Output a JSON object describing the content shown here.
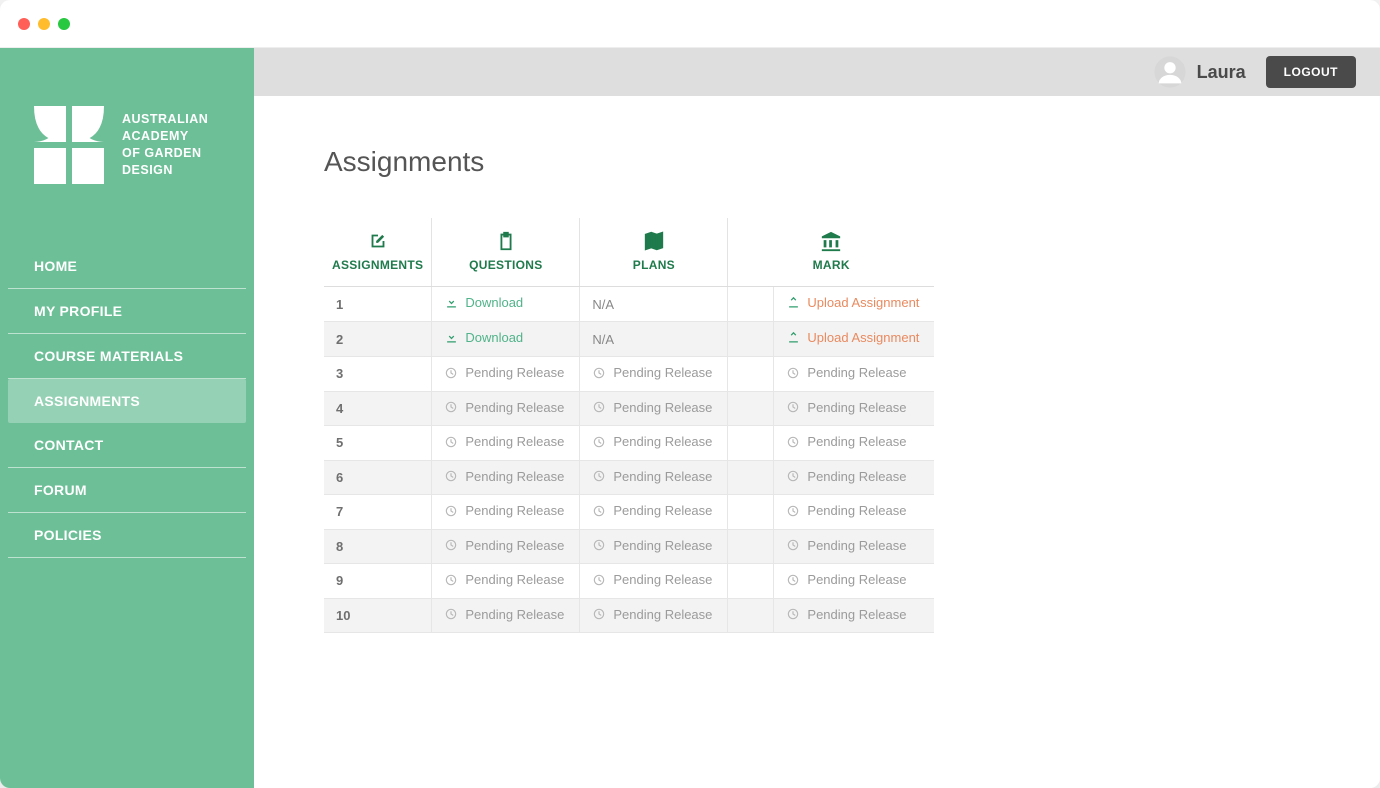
{
  "brand": {
    "line1": "AUSTRALIAN",
    "line2": "ACADEMY",
    "line3": "OF GARDEN",
    "line4": "DESIGN"
  },
  "user": {
    "name": "Laura"
  },
  "buttons": {
    "logout": "LOGOUT"
  },
  "nav": {
    "items": [
      {
        "label": "HOME",
        "active": false
      },
      {
        "label": "MY PROFILE",
        "active": false
      },
      {
        "label": "COURSE MATERIALS",
        "active": false
      },
      {
        "label": "ASSIGNMENTS",
        "active": true
      },
      {
        "label": "CONTACT",
        "active": false
      },
      {
        "label": "FORUM",
        "active": false
      },
      {
        "label": "POLICIES",
        "active": false
      }
    ]
  },
  "page": {
    "title": "Assignments"
  },
  "table": {
    "headers": {
      "assignments": "ASSIGNMENTS",
      "questions": "QUESTIONS",
      "plans": "PLANS",
      "mark": "MARK"
    },
    "labels": {
      "download": "Download",
      "upload": "Upload Assignment",
      "pending": "Pending Release",
      "na": "N/A"
    },
    "rows": [
      {
        "num": "1",
        "questions": "download",
        "plans": "na",
        "mark": "",
        "action": "upload"
      },
      {
        "num": "2",
        "questions": "download",
        "plans": "na",
        "mark": "",
        "action": "upload"
      },
      {
        "num": "3",
        "questions": "pending",
        "plans": "pending",
        "mark": "",
        "action": "pending"
      },
      {
        "num": "4",
        "questions": "pending",
        "plans": "pending",
        "mark": "",
        "action": "pending"
      },
      {
        "num": "5",
        "questions": "pending",
        "plans": "pending",
        "mark": "",
        "action": "pending"
      },
      {
        "num": "6",
        "questions": "pending",
        "plans": "pending",
        "mark": "",
        "action": "pending"
      },
      {
        "num": "7",
        "questions": "pending",
        "plans": "pending",
        "mark": "",
        "action": "pending"
      },
      {
        "num": "8",
        "questions": "pending",
        "plans": "pending",
        "mark": "",
        "action": "pending"
      },
      {
        "num": "9",
        "questions": "pending",
        "plans": "pending",
        "mark": "",
        "action": "pending"
      },
      {
        "num": "10",
        "questions": "pending",
        "plans": "pending",
        "mark": "",
        "action": "pending"
      }
    ]
  }
}
